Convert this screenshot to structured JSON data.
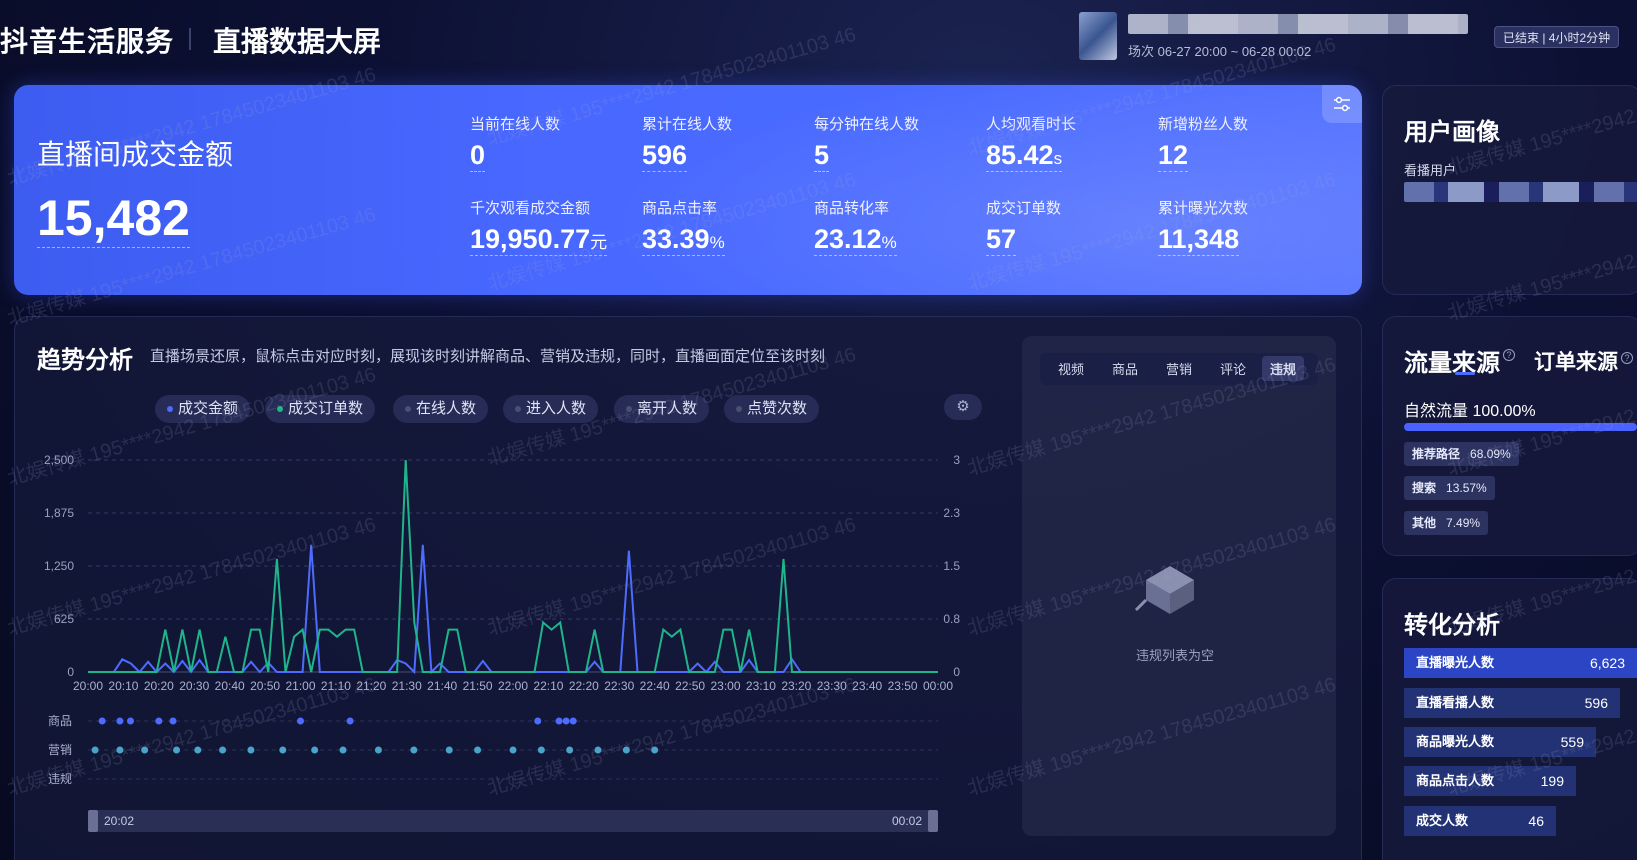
{
  "header": {
    "title": "抖音生活服务",
    "subtitle": "直播数据大屏",
    "session": "场次 06-27 20:00 ~ 06-28 00:02",
    "status": "已结束 | 4小时2分钟"
  },
  "kpi": {
    "gmv_label": "直播间成交金额",
    "gmv_value": "15,482",
    "items": [
      {
        "label": "当前在线人数",
        "value": "0",
        "unit": ""
      },
      {
        "label": "累计在线人数",
        "value": "596",
        "unit": ""
      },
      {
        "label": "每分钟在线人数",
        "value": "5",
        "unit": ""
      },
      {
        "label": "人均观看时长",
        "value": "85.42",
        "unit": "s"
      },
      {
        "label": "新增粉丝人数",
        "value": "12",
        "unit": ""
      },
      {
        "label": "千次观看成交金额",
        "value": "19,950.77",
        "unit": "元"
      },
      {
        "label": "商品点击率",
        "value": "33.39",
        "unit": "%"
      },
      {
        "label": "商品转化率",
        "value": "23.12",
        "unit": "%"
      },
      {
        "label": "成交订单数",
        "value": "57",
        "unit": ""
      },
      {
        "label": "累计曝光次数",
        "value": "11,348",
        "unit": ""
      }
    ]
  },
  "trend": {
    "title": "趋势分析",
    "description": "直播场景还原，鼠标点击对应时刻，展现该时刻讲解商品、营销及违规，同时，直播画面定位至该时刻",
    "chips": [
      {
        "label": "成交金额",
        "active": true,
        "color": "#4d6bff"
      },
      {
        "label": "成交订单数",
        "active": true,
        "color": "#1fb58a"
      },
      {
        "label": "在线人数",
        "active": false
      },
      {
        "label": "进入人数",
        "active": false
      },
      {
        "label": "离开人数",
        "active": false
      },
      {
        "label": "点赞次数",
        "active": false
      }
    ],
    "event_rows": [
      "商品",
      "营销",
      "违规"
    ],
    "slider_start": "20:02",
    "slider_end": "00:02"
  },
  "chart_data": {
    "type": "line",
    "x": [
      "20:00",
      "20:10",
      "20:20",
      "20:30",
      "20:40",
      "20:50",
      "21:00",
      "21:10",
      "21:20",
      "21:30",
      "21:40",
      "21:50",
      "22:00",
      "22:10",
      "22:20",
      "22:30",
      "22:40",
      "22:50",
      "23:00",
      "23:10",
      "23:20",
      "23:30",
      "23:40",
      "23:50",
      "00:00"
    ],
    "y_left_ticks": [
      "2,500",
      "1,875",
      "1,250",
      "625",
      "0"
    ],
    "y_right_ticks": [
      "3",
      "2.3",
      "1.5",
      "0.8",
      "0"
    ],
    "y_left_range": [
      0,
      2500
    ],
    "y_right_range": [
      0,
      3
    ],
    "series": [
      {
        "name": "成交金额",
        "axis": "left",
        "color": "#4d6bff",
        "values": [
          0,
          0,
          0,
          0,
          150,
          100,
          0,
          120,
          0,
          100,
          0,
          130,
          0,
          140,
          0,
          0,
          0,
          0,
          0,
          120,
          0,
          110,
          0,
          0,
          0,
          0,
          1500,
          0,
          0,
          0,
          0,
          0,
          0,
          0,
          0,
          0,
          140,
          100,
          0,
          1500,
          0,
          100,
          0,
          0,
          0,
          0,
          130,
          0,
          0,
          0,
          0,
          0,
          0,
          0,
          0,
          0,
          0,
          0,
          0,
          120,
          0,
          0,
          0,
          1430,
          0,
          0,
          0,
          0,
          0,
          0,
          0,
          100,
          0,
          120,
          0,
          0,
          0,
          140,
          0,
          0,
          0,
          0,
          150,
          0,
          0,
          0,
          0,
          0,
          0,
          0,
          0,
          0,
          0,
          0,
          0,
          0,
          0,
          0,
          0,
          0
        ]
      },
      {
        "name": "成交订单数",
        "axis": "right",
        "color": "#1fb58a",
        "values": [
          0,
          0,
          0,
          0,
          0,
          0,
          0,
          0,
          0,
          0.6,
          0,
          0.6,
          0,
          0.6,
          0,
          0,
          0.5,
          0,
          0,
          0.6,
          0.6,
          0,
          1.6,
          0,
          0.5,
          0.6,
          0,
          0.6,
          0.6,
          0.5,
          0.6,
          0.6,
          0,
          0,
          0,
          0,
          0,
          3,
          0.7,
          0,
          0,
          0,
          0.6,
          0.6,
          0,
          0,
          0,
          0,
          0,
          0,
          0,
          0,
          0,
          0.7,
          0.6,
          0.7,
          0,
          0,
          0,
          0.6,
          0,
          0,
          0,
          0,
          0,
          0,
          0,
          0.6,
          0.5,
          0.6,
          0,
          0,
          0,
          0,
          0.6,
          0.6,
          0,
          0.6,
          0,
          0,
          0,
          1.6,
          0,
          0,
          0,
          0,
          0,
          0,
          0,
          0,
          0,
          0,
          0,
          0,
          0,
          0,
          0,
          0,
          0,
          0
        ]
      }
    ],
    "event_markers": {
      "商品": [
        "20:04",
        "20:09",
        "20:12",
        "20:20",
        "20:24",
        "21:00",
        "21:14",
        "22:07",
        "22:13",
        "22:15",
        "22:17"
      ],
      "营销": [
        "20:02",
        "20:09",
        "20:16",
        "20:25",
        "20:31",
        "20:38",
        "20:46",
        "20:55",
        "21:04",
        "21:12",
        "21:22",
        "21:32",
        "21:42",
        "21:50",
        "22:00",
        "22:08",
        "22:16",
        "22:24",
        "22:32",
        "22:40"
      ],
      "违规": []
    }
  },
  "side": {
    "tabs": [
      "视频",
      "商品",
      "营销",
      "评论",
      "违规"
    ],
    "active_tab": "违规",
    "empty_text": "违规列表为空"
  },
  "portrait": {
    "title": "用户画像",
    "subtitle": "看播用户"
  },
  "traffic": {
    "title": "流量来源",
    "title2": "订单来源",
    "natural": "自然流量 100.00%",
    "items": [
      {
        "label": "推荐路径",
        "value": "68.09%"
      },
      {
        "label": "搜索",
        "value": "13.57%"
      },
      {
        "label": "其他",
        "value": "7.49%"
      }
    ]
  },
  "conversion": {
    "title": "转化分析",
    "rows": [
      {
        "label": "直播曝光人数",
        "value": "6,623"
      },
      {
        "label": "直播看播人数",
        "value": "596"
      },
      {
        "label": "商品曝光人数",
        "value": "559"
      },
      {
        "label": "商品点击人数",
        "value": "199"
      },
      {
        "label": "成交人数",
        "value": "46"
      }
    ]
  },
  "watermark_text": "北娱传媒 195****2942 17845023401103 46",
  "colors": {
    "accent": "#4d6bff",
    "orders": "#1fb58a",
    "card": "#4868ff"
  }
}
